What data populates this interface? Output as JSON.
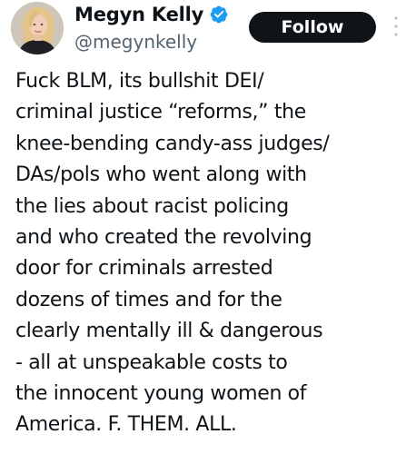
{
  "author": {
    "display_name": "Megyn Kelly",
    "handle": "@megynkelly",
    "verified_icon": "verified-badge-icon",
    "verified_color": "#1d9bf0"
  },
  "actions": {
    "follow_label": "Follow",
    "more_icon": "more-vertical-icon"
  },
  "tweet": {
    "lines": [
      "Fuck BLM, its bullshit DEI/",
      "criminal justice “reforms,” the",
      "knee-bending candy-ass judges/",
      "DAs/pols who went along with",
      "the lies about racist policing",
      "and who created the revolving",
      "door for criminals arrested",
      "dozens of times and for the",
      "clearly mentally ill & dangerous",
      "- all at unspeakable costs to",
      "the innocent young women of",
      "America. F. THEM. ALL."
    ]
  },
  "colors": {
    "text": "#0f1419",
    "secondary_text": "#536471",
    "button_bg": "#0f1419",
    "button_text": "#ffffff"
  }
}
